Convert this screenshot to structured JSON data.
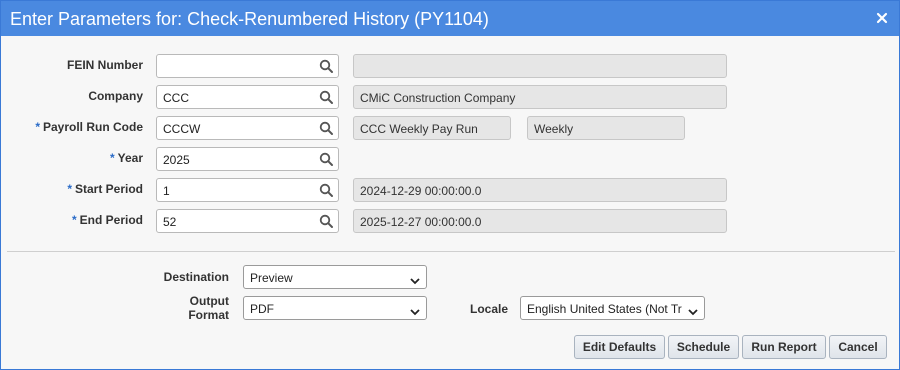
{
  "dialog": {
    "title": "Enter Parameters for: Check-Renumbered History (PY1104)"
  },
  "fields": {
    "fein": {
      "label": "FEIN Number",
      "required": false,
      "value": "",
      "description": ""
    },
    "company": {
      "label": "Company",
      "required": false,
      "value": "CCC",
      "description": "CMiC Construction Company"
    },
    "payroll_run_code": {
      "label": "Payroll Run Code",
      "required": true,
      "value": "CCCW",
      "description": "CCC Weekly Pay Run",
      "frequency": "Weekly"
    },
    "year": {
      "label": "Year",
      "required": true,
      "value": "2025"
    },
    "start_period": {
      "label": "Start Period",
      "required": true,
      "value": "1",
      "description": "2024-12-29 00:00:00.0"
    },
    "end_period": {
      "label": "End Period",
      "required": true,
      "value": "52",
      "description": "2025-12-27 00:00:00.0"
    }
  },
  "required_marker": "*",
  "output": {
    "destination_label": "Destination",
    "destination_value": "Preview",
    "format_label_line1": "Output",
    "format_label_line2": "Format",
    "format_value": "PDF",
    "locale_label": "Locale",
    "locale_value": "English United States (Not Tr"
  },
  "buttons": {
    "edit_defaults": "Edit Defaults",
    "schedule": "Schedule",
    "run_report": "Run Report",
    "cancel": "Cancel"
  },
  "icons": {
    "close": "close-icon",
    "search": "search-icon",
    "dropdown": "chevron-down-icon"
  },
  "colors": {
    "titlebar": "#4a89e0",
    "required_marker": "#2a6bc7"
  }
}
